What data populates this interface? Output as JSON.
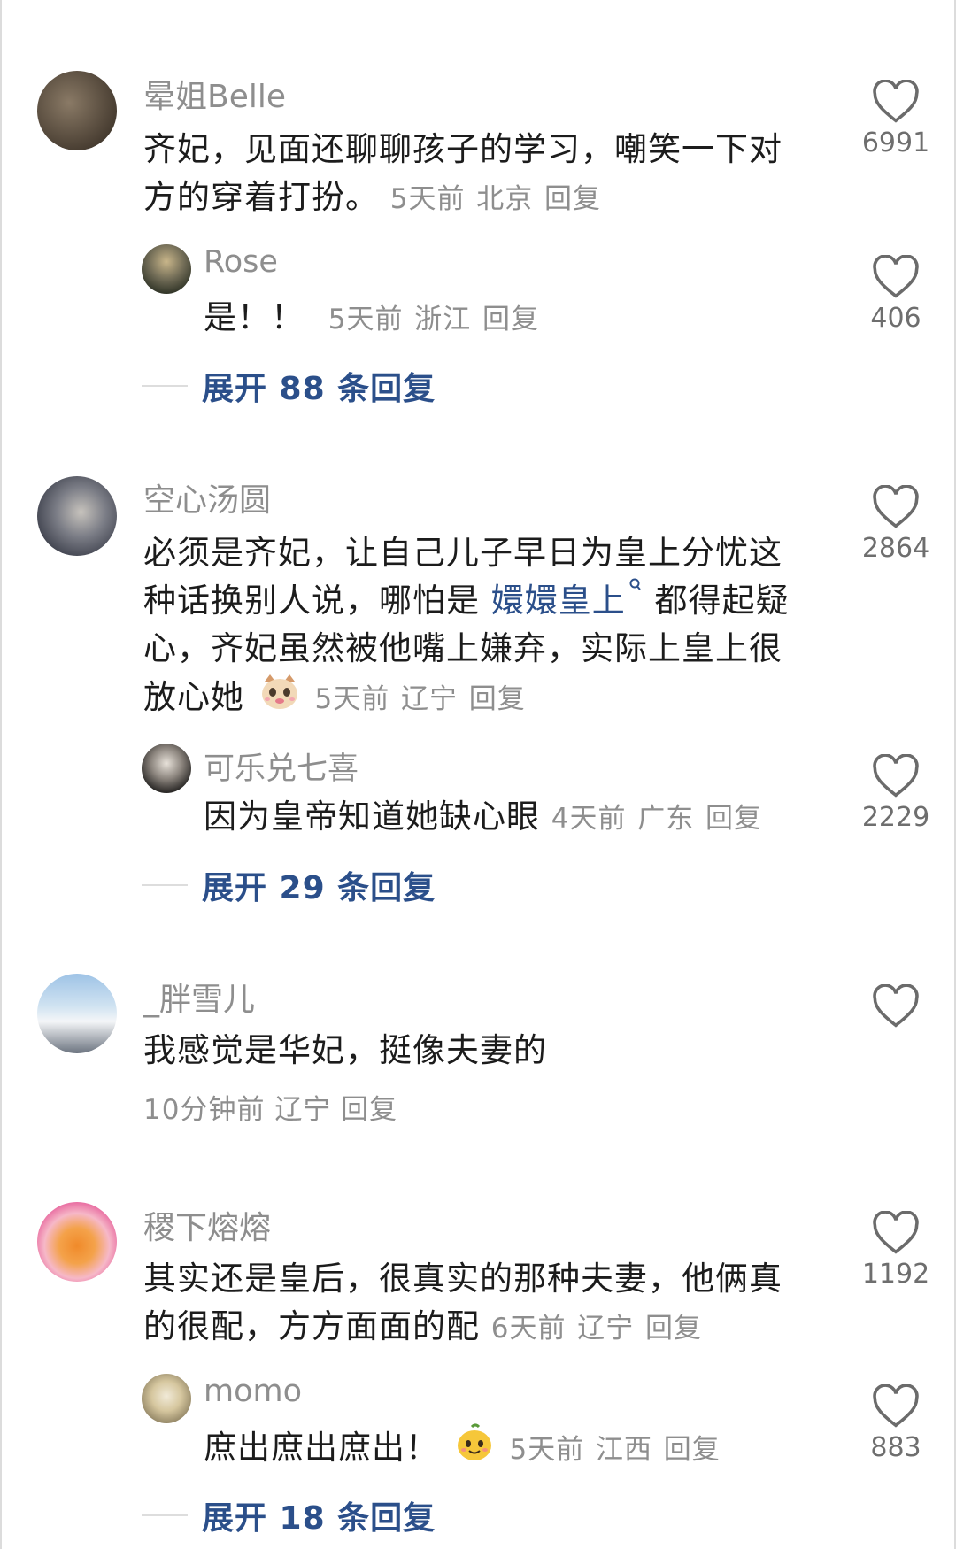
{
  "comments": [
    {
      "user": "晕姐Belle",
      "text": "齐妃，见面还聊聊孩子的学习，嘲笑一下对方的穿着打扮。",
      "time": "5天前",
      "location": "北京",
      "reply": "回复",
      "likes": "6991",
      "sub": {
        "user": "Rose",
        "text": "是！！",
        "time": "5天前",
        "location": "浙江",
        "reply": "回复",
        "likes": "406"
      },
      "expand": "展开 88 条回复"
    },
    {
      "user": "空心汤圆",
      "text_before": "必须是齐妃，让自己儿子早日为皇上分忧这种话换别人说，哪怕是",
      "link": "嬛嬛皇上",
      "text_after": "都得起疑心，齐妃虽然被他嘴上嫌弃，实际上皇上很放心她",
      "time": "5天前",
      "location": "辽宁",
      "reply": "回复",
      "likes": "2864",
      "sub": {
        "user": "可乐兑七喜",
        "text": "因为皇帝知道她缺心眼",
        "time": "4天前",
        "location": "广东",
        "reply": "回复",
        "likes": "2229"
      },
      "expand": "展开 29 条回复"
    },
    {
      "user": "_胖雪儿",
      "text": "我感觉是华妃，挺像夫妻的",
      "time": "10分钟前",
      "location": "辽宁",
      "reply": "回复",
      "likes": ""
    },
    {
      "user": "稷下熔熔",
      "text": "其实还是皇后，很真实的那种夫妻，他俩真的很配，方方面面的配",
      "time": "6天前",
      "location": "辽宁",
      "reply": "回复",
      "likes": "1192",
      "sub": {
        "user": "momo",
        "text": "庶出庶出庶出！",
        "time": "5天前",
        "location": "江西",
        "reply": "回复",
        "likes": "883"
      },
      "expand": "展开 18 条回复"
    }
  ],
  "icons": {
    "like": "heart-outline-icon",
    "search": "search-icon",
    "emoji_cat": "cat-emoji",
    "emoji_mango": "mango-emoji"
  },
  "colors": {
    "link": "#2b4f8a",
    "meta": "#8e8e8e"
  }
}
